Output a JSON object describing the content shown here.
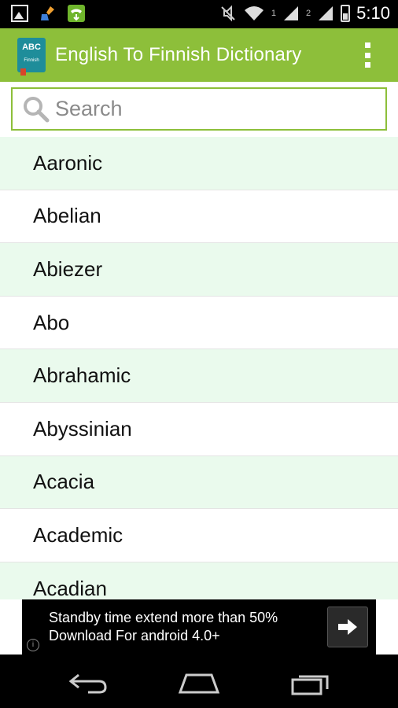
{
  "status_bar": {
    "time": "5:10",
    "sim1_label": "1",
    "sim2_label": "2"
  },
  "app": {
    "title": "English To Finnish Dictionary",
    "logo_text_top": "ABC",
    "logo_text_bottom": "Finnish",
    "accent_color": "#8dbf3a",
    "row_alt_color": "#eafaed"
  },
  "search": {
    "placeholder": "Search",
    "value": ""
  },
  "words": [
    "Aaronic",
    "Abelian",
    "Abiezer",
    "Abo",
    "Abrahamic",
    "Abyssinian",
    "Acacia",
    "Academic",
    "Acadian"
  ],
  "ad": {
    "line1": "Standby time extend more than 50%",
    "line2": "Download For android 4.0+",
    "info_label": "i"
  },
  "icons": {
    "status_left": [
      "gallery-icon",
      "cleaner-icon",
      "phone-icon"
    ],
    "status_right": [
      "mute-icon",
      "wifi-icon",
      "signal-icon",
      "battery-icon"
    ],
    "nav": [
      "back-icon",
      "home-icon",
      "recent-apps-icon"
    ]
  }
}
